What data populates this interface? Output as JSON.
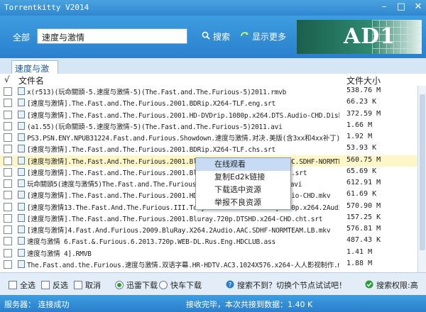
{
  "window": {
    "title": "Torrentkitty V2014"
  },
  "header": {
    "all_label": "全部",
    "search_value": "速度与激情",
    "search_button": "搜索",
    "more_button": "显示更多",
    "ad_text": "AD1"
  },
  "tab": {
    "label": "速度与激情"
  },
  "list": {
    "col_name": "文件名",
    "col_size": "文件大小",
    "check_mark": "√",
    "rows": [
      {
        "name": "x(r513)(玩命關頭-5.速度与激情-5)(The.Fast.and.The.Furious-5)2011.rmvb",
        "size": "538.76 M"
      },
      {
        "name": "[速度与激情].The.Fast.and.The.Furious.2001.BDRip.X264-TLF.eng.srt",
        "size": "66.23 K"
      },
      {
        "name": "[速度与激情].The.Fast.and.The.Furious.2001.HD-DVDrip.1080p.x264.DTS.Audio-CHD.Disk2.avi",
        "size": "372.59 M"
      },
      {
        "name": "(a1.55)(玩命關頭-5.速度与激情-5)(The.Fast.and.The.Furious-5)2011.avi",
        "size": "1.66 M"
      },
      {
        "name": "PS3.PSN.ENY.NPUB31224.Fast.and.Furious.Showdown.速度与激情.对决.美版(含3xx和4xx补丁)-MYED",
        "size": "1.92 M"
      },
      {
        "name": "[速度与激情].The.Fast.and.The.Furious.2001.BDRip.X264-TLF.chs.srt",
        "size": "53.93 K"
      },
      {
        "name": "[速度与激情].The.Fast.And.The.Furious.2001.BluRay.720p.x264.2Audio.AAC.SDHF-NORMTEAM.LB.mkv",
        "size": "560.75 M"
      },
      {
        "name": "[速度与激情].The.Fast.and.The.Furious.2001.Bluray.720p.DTSHD.x264-CHD.srt",
        "size": "65.69 K"
      },
      {
        "name": "玩命關頭5(速度与激情5)The.Fast.and.The.Furious.5.2011.DVDRip.XviD-AC3.avi",
        "size": "612.91 M"
      },
      {
        "name": "[速度与激情].The.Fast.and.The.Furious.2001.HDVDRip.1080p.x264.DTS.Audio-CHD.mkv",
        "size": "61.69 K"
      },
      {
        "name": "[速度与激情13.The.Fast.And.The.Furious.III.Tokyo.Drift.2006.BluRay.720p.x264.2Audio.AAC.SDHF-NT",
        "size": "570.90 M"
      },
      {
        "name": "[速度与激情].The.Fast.and.The.Furious.2001.Bluray.720p.DTSHD.x264-CHD.cht.srt",
        "size": "157.25 K"
      },
      {
        "name": "[速度与激情]4.Fast.And.Furious.2009.BluRay.X264.2Audio.AAC.SDHF-NORMTEAM.LB.mkv",
        "size": "576.81 M"
      },
      {
        "name": "速度与激情 6.Fast.&.Furious.6.2013.720p.WEB-DL.Rus.Eng.HDCLUB.ass",
        "size": "487.43 K"
      },
      {
        "name": "速度与激情 4].RMVB",
        "size": "1.41 M"
      },
      {
        "name": "The.Fast.and.the.Furious.速度与激情.双语字幕.HR-HDTV.AC3.1024X576.x264-人人影视制作.mkv",
        "size": "1.88 M"
      }
    ],
    "selected_index": 6
  },
  "context_menu": {
    "items": [
      "在线观看",
      "复制Ed2k链接",
      "下载选中资源",
      "举报不良资源"
    ]
  },
  "bottom": {
    "select_all": "全选",
    "invert": "反选",
    "cancel": "取消",
    "xunlei": "迅雷下载",
    "kuaiche": "快车下载",
    "notfound": "搜索不到？切换个节点试试吧！",
    "permission": "搜索权限:高"
  },
  "status": {
    "server": "服务器： 连接成功",
    "message": "接收完毕，本次共接到数据：1.40 K"
  }
}
